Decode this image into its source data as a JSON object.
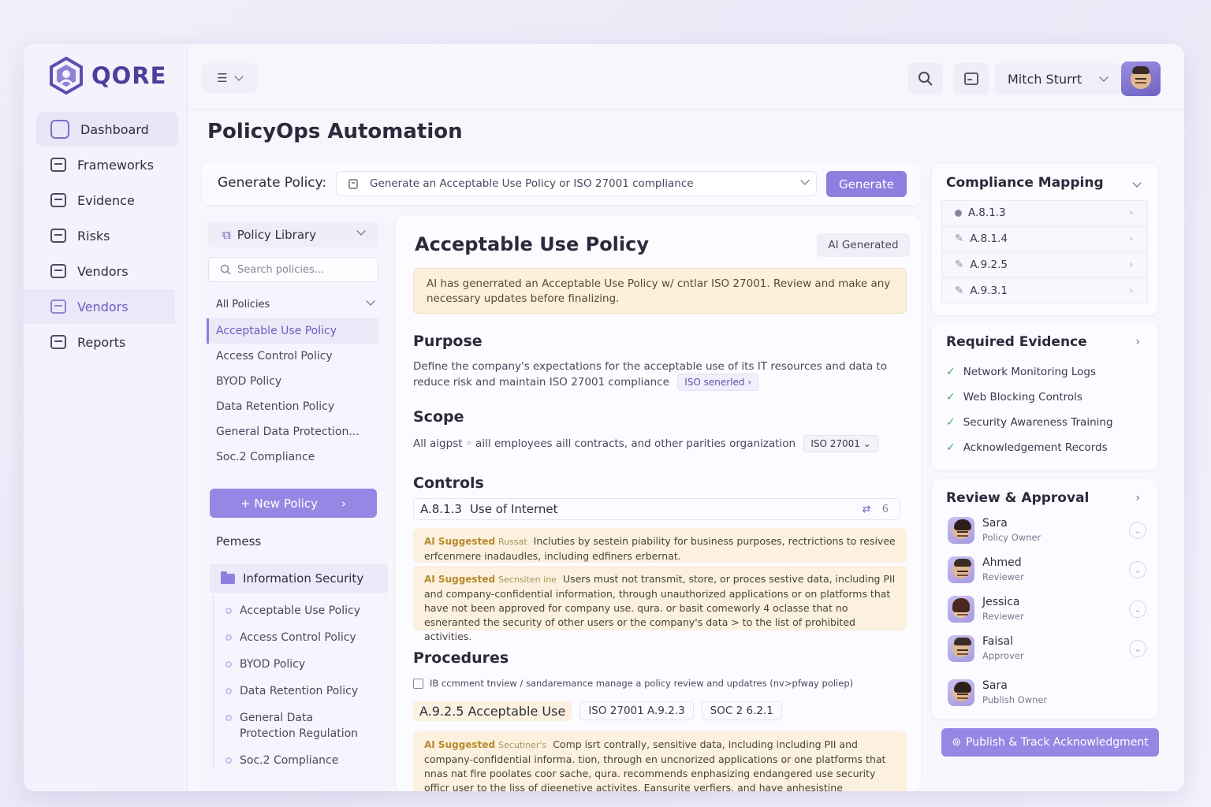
{
  "app": {
    "brand": "QORE"
  },
  "sidebar": {
    "items": [
      {
        "label": "Dashboard",
        "icon": "dashboard-icon"
      },
      {
        "label": "Frameworks",
        "icon": "frameworks-icon"
      },
      {
        "label": "Evidence",
        "icon": "evidence-icon"
      },
      {
        "label": "Risks",
        "icon": "risks-icon"
      },
      {
        "label": "Vendors",
        "icon": "vendors-icon"
      },
      {
        "label": "Vendors",
        "icon": "vendors-icon"
      },
      {
        "label": "Reports",
        "icon": "reports-icon"
      }
    ]
  },
  "topbar": {
    "user_name": "Mitch Sturrt"
  },
  "page": {
    "title": "PolicyOps Automation"
  },
  "generate": {
    "label": "Generate Policy:",
    "input_value": "Generate an Acceptable Use Policy or ISO 27001 compliance",
    "button": "Generate"
  },
  "library": {
    "header": "Policy Library",
    "search_placeholder": "Search policies...",
    "filter": "All Policies",
    "items": [
      "Acceptable Use Policy",
      "Access Control Policy",
      "BYOD Policy",
      "Data Retention Policy",
      "General Data Protection...",
      "Soc.2 Compliance"
    ],
    "new_button": "+ New Policy",
    "permissions": "Pemess",
    "folder": "Information Security",
    "folder_items": [
      "Acceptable Use Policy",
      "Access Control Policy",
      "BYOD Policy",
      "Data Retention Policy",
      "General Data Protection Regulation",
      "Soc.2 Compliance"
    ]
  },
  "document": {
    "title": "Acceptable Use Policy",
    "badge": "AI Generated",
    "ai_note": "AI has generrated an Acceptable Use Policy w/ cntlar ISO 27001. Review and make any necessary updates before finalizing.",
    "purpose": {
      "heading": "Purpose",
      "text": "Define the company's expectations for the acceptable use of its IT resources and data to reduce risk and maintain ISO 27001 compliance",
      "tag": "ISO senerled ›"
    },
    "scope": {
      "heading": "Scope",
      "text": "All aigpst ◦ aill employees aill contracts, and other parities organization",
      "tag": "ISO 27001 ⌄"
    },
    "controls": {
      "heading": "Controls",
      "row_id": "A.8.1.3",
      "row_label": "Use of Internet",
      "row_count": "6",
      "suggestion_1": {
        "label": "AI Suggested",
        "sub": "Russat",
        "text": "Incluties by sestein piability for business purposes, rectrictions to resivee erfcenmere inadaudles, including edfiners erbernat."
      },
      "suggestion_2": {
        "label": "AI Suggested",
        "sub": "Secnsiten ine",
        "text": "Users must not transmit, store, or proces sestive data, including PII and company-confidential information, through unauthorized applications or on platforms that have not been approved for company use. qura. or basit comeworly 4 oclasse that no esneranted the security of other users or the company's data > to the list of prohibited activities."
      }
    },
    "procedures": {
      "heading": "Procedures",
      "check_text": "IB ccmment tnview / sandaremance manage a policy review and updatres (nv>pfway poliep)",
      "row_label": "A.9.2.5 Acceptable Use",
      "chip_1": "ISO 27001 A.9.2.3",
      "chip_2": "SOC 2 6.2.1",
      "suggestion": {
        "label": "AI Suggested",
        "sub": "Secutiner's",
        "text": "Comp isrt contrally, sensitive data, including including PII and company-confidential informa. tion, through en uncnorized applications or one platforms that nnas nat fire poolates coor sache, qura. recommends enphasizing endangered use security officr user to the liss of dieenetive activites. Eansurite verfiers, and have anhesistine"
      }
    }
  },
  "compliance": {
    "heading": "Compliance Mapping",
    "items": [
      "A.8.1.3",
      "A.8.1.4",
      "A.9.2.5",
      "A.9.3.1"
    ]
  },
  "evidence": {
    "heading": "Required Evidence",
    "items": [
      "Network Monitoring Logs",
      "Web Blocking Controls",
      "Security Awareness Training",
      "Acknowledgement Records"
    ]
  },
  "review": {
    "heading": "Review & Approval",
    "people": [
      {
        "name": "Sara",
        "role": "Policy Owner"
      },
      {
        "name": "Ahmed",
        "role": "Reviewer"
      },
      {
        "name": "Jessica",
        "role": "Reviewer"
      },
      {
        "name": "Faisal",
        "role": "Approver"
      },
      {
        "name": "Sara",
        "role": "Publish Owner"
      }
    ],
    "publish_button": "Publish & Track Acknowledgment"
  },
  "colors": {
    "accent": "#8d7ee0",
    "brand": "#4b3f9a",
    "warning_bg": "#fbf1de"
  }
}
